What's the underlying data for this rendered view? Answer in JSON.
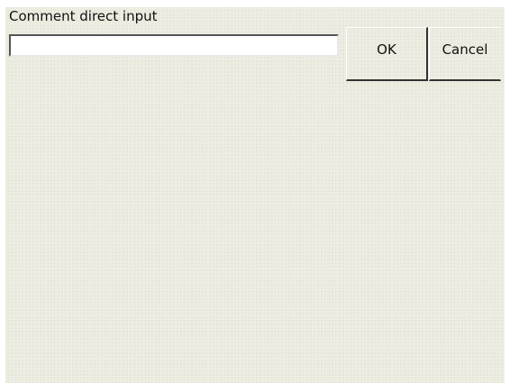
{
  "dialog": {
    "title": "Comment direct input",
    "input": {
      "value": "",
      "placeholder": ""
    },
    "buttons": {
      "ok_label": "OK",
      "cancel_label": "Cancel"
    },
    "colors": {
      "panel_background": "#ecebdf",
      "input_background": "#ffffff",
      "text": "#111111"
    }
  }
}
